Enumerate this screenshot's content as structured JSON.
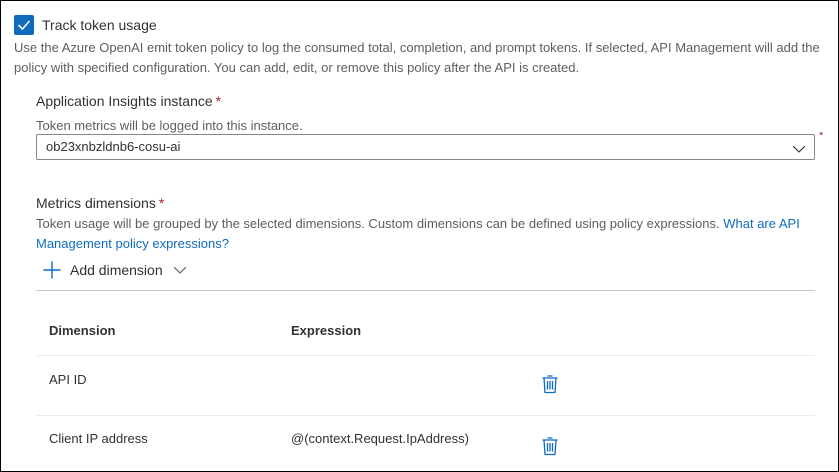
{
  "track_token_usage": {
    "checked": true,
    "label": "Track token usage",
    "description": "Use the Azure OpenAI emit token policy to log the consumed total, completion, and prompt tokens. If selected, API Management will add the policy with specified configuration. You can add, edit, or remove this policy after the API is created."
  },
  "app_insights": {
    "label": "Application Insights instance",
    "required_mark": "*",
    "hint": "Token metrics will be logged into this instance.",
    "selected_value": "ob23xnbzldnb6-cosu-ai",
    "field_required_mark": "*"
  },
  "metrics_dimensions": {
    "label": "Metrics dimensions",
    "required_mark": "*",
    "hint": "Token usage will be grouped by the selected dimensions. Custom dimensions can be defined using policy expressions.",
    "link_text": "What are API Management policy expressions?",
    "add_button_label": "Add dimension"
  },
  "table": {
    "columns": [
      "Dimension",
      "Expression"
    ],
    "rows": [
      {
        "dimension": "API ID",
        "expression": ""
      },
      {
        "dimension": "Client IP address",
        "expression": "@(context.Request.IpAddress)"
      }
    ]
  },
  "colors": {
    "accent": "#0f6cbd",
    "required": "#a4262c",
    "text": "#323130",
    "secondary_text": "#605e5c"
  },
  "icons": {
    "checkbox": "checkmark-icon",
    "select": "chevron-down-icon",
    "add": "plus-icon",
    "delete": "trash-icon"
  }
}
